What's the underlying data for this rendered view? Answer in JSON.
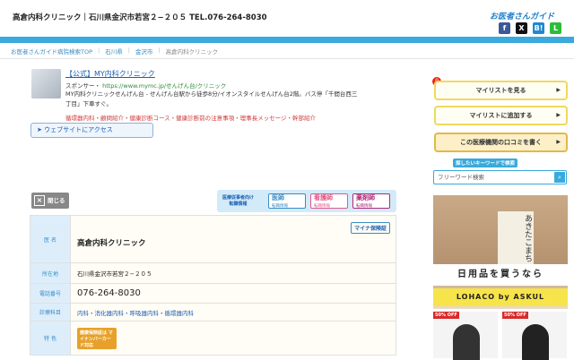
{
  "header": {
    "title": "高倉内科クリニック｜石川県金沢市若宮２−２０５ TEL.076-264-8030",
    "logo": "お医者さんガイド",
    "social": [
      "f",
      "X",
      "B!",
      "L"
    ]
  },
  "breadcrumb": [
    "お医者さんガイド病院検索TOP",
    "石川県",
    "金沢市",
    "高倉内科クリニック"
  ],
  "ad": {
    "title": "【公式】MY内科クリニック",
    "sponsor": "スポンサー・",
    "url": "https://www.mymc.jp/せんげん台/クリニック",
    "desc": "MY内科クリニックせんげん台 - せんげん台駅から徒歩8分/イオンスタイルせんげん台2階。バス停「千間台西三丁目」下車すぐ。",
    "links": "循環器内科・顧問紹介・健康診断コース・健康診断前の注意事項・理事長メッセージ・幹部紹介",
    "button": "➤ ウェブサイトにアクセス"
  },
  "close_label": "閉じる",
  "jobs": {
    "label": "医療従事者向け\n転職情報",
    "items": [
      {
        "title": "医師",
        "sub": "転職情報",
        "color": "#3a8cc4"
      },
      {
        "title": "看護師",
        "sub": "転職情報",
        "color": "#e05a8a"
      },
      {
        "title": "薬剤師",
        "sub": "転職情報",
        "color": "#b02a7a"
      }
    ]
  },
  "clinic": {
    "name_label": "医 名",
    "name": "高倉内科クリニック",
    "myna": "マイナ保険証",
    "address_label": "所在地",
    "address": "石川県金沢市若宮２−２０５",
    "phone_label": "電話番号",
    "phone": "076-264-8030",
    "dept_label": "診療科目",
    "dept": "内科・消化器内科・呼吸器内科・循環器内科",
    "feature_label": "特 色",
    "feature_badge": "健康保険証は マイナンバーカード対応"
  },
  "sidebar": {
    "badge": "0",
    "buttons": [
      "マイリストを見る",
      "マイリストに追加する",
      "この医療機関の口コミを書く"
    ],
    "keyword_label": "探したいキーワードで検索",
    "search_placeholder": "フリーワード検索"
  },
  "ads": {
    "product": "あきたこまち",
    "tagline": "日用品を買うなら",
    "brand": "LOHACO by ASKUL",
    "off1": "50% OFF",
    "off2": "50% OFF"
  }
}
